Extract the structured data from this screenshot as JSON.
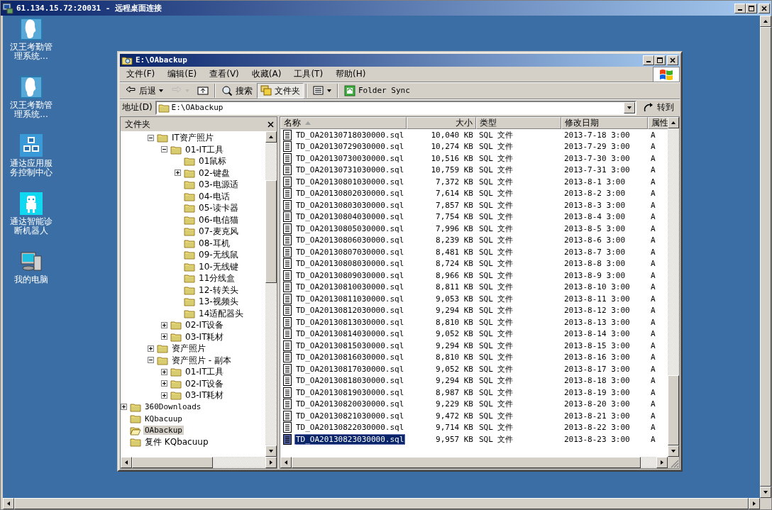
{
  "remote_window": {
    "title": "61.134.15.72:20031 - 远程桌面连接"
  },
  "desktop_icons": [
    {
      "label": "汉王考勤管理系统...",
      "kind": "silhouette"
    },
    {
      "label": "汉王考勤管理系统...",
      "kind": "silhouette"
    },
    {
      "label": "通达应用服务控制中心",
      "kind": "blocks"
    },
    {
      "label": "通达智能诊断机器人",
      "kind": "robot"
    },
    {
      "label": "我的电脑",
      "kind": "computer"
    }
  ],
  "explorer": {
    "title": "E:\\OAbackup",
    "menu": [
      "文件(F)",
      "编辑(E)",
      "查看(V)",
      "收藏(A)",
      "工具(T)",
      "帮助(H)"
    ],
    "toolbar": [
      {
        "kind": "back",
        "label": "后退",
        "disabled": false,
        "pressed": false
      },
      {
        "kind": "forward",
        "disabled": true,
        "pressed": false
      },
      {
        "kind": "up",
        "disabled": false,
        "pressed": false
      },
      {
        "kind": "search",
        "label": "搜索",
        "disabled": false,
        "pressed": false
      },
      {
        "kind": "folders",
        "label": "文件夹",
        "disabled": false,
        "pressed": true
      },
      {
        "kind": "views",
        "disabled": false,
        "pressed": false
      },
      {
        "kind": "sync",
        "label": "Folder Sync",
        "disabled": false,
        "pressed": false
      }
    ],
    "address": {
      "label": "地址(D)",
      "value": "E:\\OAbackup",
      "go": "转到"
    },
    "folder_pane": {
      "title": "文件夹",
      "tree": [
        {
          "children": [
            {
              "children": [
                {
                  "label": "IT资产照片",
                  "expanded": true,
                  "selected": false,
                  "children": [
                    {
                      "label": "01-IT工具",
                      "expanded": true,
                      "selected": false,
                      "children": [
                        {
                          "label": "01鼠标",
                          "selected": false
                        },
                        {
                          "label": "02-键盘",
                          "expanded": false,
                          "selected": false
                        },
                        {
                          "label": "03-电源适",
                          "selected": false
                        },
                        {
                          "label": "04-电话",
                          "selected": false
                        },
                        {
                          "label": "05-读卡器",
                          "selected": false
                        },
                        {
                          "label": "06-电信猫",
                          "selected": false
                        },
                        {
                          "label": "07-麦克风",
                          "selected": false
                        },
                        {
                          "label": "08-耳机",
                          "selected": false
                        },
                        {
                          "label": "09-无线鼠",
                          "selected": false
                        },
                        {
                          "label": "10-无线键",
                          "selected": false
                        },
                        {
                          "label": "11分线盒",
                          "selected": false
                        },
                        {
                          "label": "12-转关头",
                          "selected": false
                        },
                        {
                          "label": "13-视频头",
                          "selected": false
                        },
                        {
                          "label": "14适配器头",
                          "selected": false
                        }
                      ]
                    },
                    {
                      "label": "02-IT设备",
                      "expanded": false,
                      "selected": false
                    },
                    {
                      "label": "03-IT耗材",
                      "expanded": false,
                      "selected": false
                    }
                  ]
                },
                {
                  "label": "资产照片",
                  "expanded": false,
                  "selected": false
                },
                {
                  "label": "资产照片 - 副本",
                  "expanded": true,
                  "selected": false,
                  "children": [
                    {
                      "label": "01-IT工具",
                      "expanded": false,
                      "selected": false
                    },
                    {
                      "label": "02-IT设备",
                      "expanded": false,
                      "selected": false
                    },
                    {
                      "label": "03-IT耗材",
                      "expanded": false,
                      "selected": false
                    }
                  ]
                }
              ]
            }
          ]
        },
        {
          "label": "360Downloads",
          "expanded": false,
          "selected": false
        },
        {
          "label": "KQbacuup",
          "selected": false
        },
        {
          "label": "OAbackup",
          "selected": true
        },
        {
          "label": "复件 KQbacuup",
          "selected": false
        }
      ]
    },
    "file_list": {
      "columns": [
        {
          "label": "名称",
          "sorted": true
        },
        {
          "label": "大小",
          "sorted": false
        },
        {
          "label": "类型",
          "sorted": false
        },
        {
          "label": "修改日期",
          "sorted": false
        },
        {
          "label": "属性",
          "sorted": false
        }
      ],
      "rows": [
        {
          "name": "TD_OA20130718030000.sql",
          "size": "10,040 KB",
          "type": "SQL 文件",
          "modified": "2013-7-18 3:00",
          "attributes": "A",
          "selected": false
        },
        {
          "name": "TD_OA20130729030000.sql",
          "size": "10,274 KB",
          "type": "SQL 文件",
          "modified": "2013-7-29 3:00",
          "attributes": "A",
          "selected": false
        },
        {
          "name": "TD_OA20130730030000.sql",
          "size": "10,516 KB",
          "type": "SQL 文件",
          "modified": "2013-7-30 3:00",
          "attributes": "A",
          "selected": false
        },
        {
          "name": "TD_OA20130731030000.sql",
          "size": "10,759 KB",
          "type": "SQL 文件",
          "modified": "2013-7-31 3:00",
          "attributes": "A",
          "selected": false
        },
        {
          "name": "TD_OA20130801030000.sql",
          "size": "7,372 KB",
          "type": "SQL 文件",
          "modified": "2013-8-1 3:00",
          "attributes": "A",
          "selected": false
        },
        {
          "name": "TD_OA20130802030000.sql",
          "size": "7,614 KB",
          "type": "SQL 文件",
          "modified": "2013-8-2 3:00",
          "attributes": "A",
          "selected": false
        },
        {
          "name": "TD_OA20130803030000.sql",
          "size": "7,857 KB",
          "type": "SQL 文件",
          "modified": "2013-8-3 3:00",
          "attributes": "A",
          "selected": false
        },
        {
          "name": "TD_OA20130804030000.sql",
          "size": "7,754 KB",
          "type": "SQL 文件",
          "modified": "2013-8-4 3:00",
          "attributes": "A",
          "selected": false
        },
        {
          "name": "TD_OA20130805030000.sql",
          "size": "7,996 KB",
          "type": "SQL 文件",
          "modified": "2013-8-5 3:00",
          "attributes": "A",
          "selected": false
        },
        {
          "name": "TD_OA20130806030000.sql",
          "size": "8,239 KB",
          "type": "SQL 文件",
          "modified": "2013-8-6 3:00",
          "attributes": "A",
          "selected": false
        },
        {
          "name": "TD_OA20130807030000.sql",
          "size": "8,481 KB",
          "type": "SQL 文件",
          "modified": "2013-8-7 3:00",
          "attributes": "A",
          "selected": false
        },
        {
          "name": "TD_OA20130808030000.sql",
          "size": "8,724 KB",
          "type": "SQL 文件",
          "modified": "2013-8-8 3:00",
          "attributes": "A",
          "selected": false
        },
        {
          "name": "TD_OA20130809030000.sql",
          "size": "8,966 KB",
          "type": "SQL 文件",
          "modified": "2013-8-9 3:00",
          "attributes": "A",
          "selected": false
        },
        {
          "name": "TD_OA20130810030000.sql",
          "size": "8,811 KB",
          "type": "SQL 文件",
          "modified": "2013-8-10 3:00",
          "attributes": "A",
          "selected": false
        },
        {
          "name": "TD_OA20130811030000.sql",
          "size": "9,053 KB",
          "type": "SQL 文件",
          "modified": "2013-8-11 3:00",
          "attributes": "A",
          "selected": false
        },
        {
          "name": "TD_OA20130812030000.sql",
          "size": "9,294 KB",
          "type": "SQL 文件",
          "modified": "2013-8-12 3:00",
          "attributes": "A",
          "selected": false
        },
        {
          "name": "TD_OA20130813030000.sql",
          "size": "8,810 KB",
          "type": "SQL 文件",
          "modified": "2013-8-13 3:00",
          "attributes": "A",
          "selected": false
        },
        {
          "name": "TD_OA20130814030000.sql",
          "size": "9,052 KB",
          "type": "SQL 文件",
          "modified": "2013-8-14 3:00",
          "attributes": "A",
          "selected": false
        },
        {
          "name": "TD_OA20130815030000.sql",
          "size": "9,294 KB",
          "type": "SQL 文件",
          "modified": "2013-8-15 3:00",
          "attributes": "A",
          "selected": false
        },
        {
          "name": "TD_OA20130816030000.sql",
          "size": "8,810 KB",
          "type": "SQL 文件",
          "modified": "2013-8-16 3:00",
          "attributes": "A",
          "selected": false
        },
        {
          "name": "TD_OA20130817030000.sql",
          "size": "9,052 KB",
          "type": "SQL 文件",
          "modified": "2013-8-17 3:00",
          "attributes": "A",
          "selected": false
        },
        {
          "name": "TD_OA20130818030000.sql",
          "size": "9,294 KB",
          "type": "SQL 文件",
          "modified": "2013-8-18 3:00",
          "attributes": "A",
          "selected": false
        },
        {
          "name": "TD_OA20130819030000.sql",
          "size": "8,987 KB",
          "type": "SQL 文件",
          "modified": "2013-8-19 3:00",
          "attributes": "A",
          "selected": false
        },
        {
          "name": "TD_OA20130820030000.sql",
          "size": "9,229 KB",
          "type": "SQL 文件",
          "modified": "2013-8-20 3:00",
          "attributes": "A",
          "selected": false
        },
        {
          "name": "TD_OA20130821030000.sql",
          "size": "9,472 KB",
          "type": "SQL 文件",
          "modified": "2013-8-21 3:00",
          "attributes": "A",
          "selected": false
        },
        {
          "name": "TD_OA20130822030000.sql",
          "size": "9,714 KB",
          "type": "SQL 文件",
          "modified": "2013-8-22 3:00",
          "attributes": "A",
          "selected": false
        },
        {
          "name": "TD_OA20130823030000.sql",
          "size": "9,957 KB",
          "type": "SQL 文件",
          "modified": "2013-8-23 3:00",
          "attributes": "A",
          "selected": true
        }
      ]
    }
  }
}
